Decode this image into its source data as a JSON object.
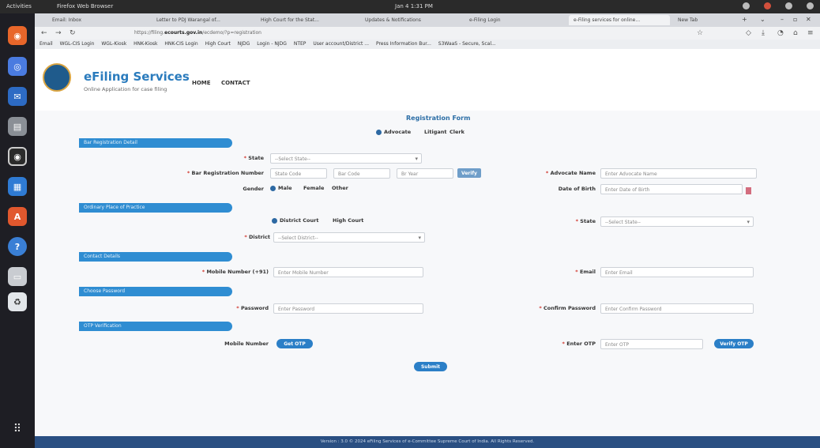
{
  "topbar": {
    "activities": "Activities",
    "app": "Firefox Web Browser",
    "clock": "Jan 4 1:31 PM"
  },
  "dock": {
    "icons": [
      "firefox-icon",
      "chrome-icon",
      "thunderbird-icon",
      "files-icon",
      "rhythmbox-icon",
      "writer-icon",
      "software-icon",
      "help-icon",
      "disk-icon",
      "trash-icon",
      "apps-grid-icon"
    ]
  },
  "browser": {
    "tabs": [
      "Email: Inbox",
      "Letter to PDJ Warangal of...",
      "High Court for the Stat...",
      "Updates & Notifications",
      "e-Filing Login",
      "e-Filing services for online...",
      "New Tab"
    ],
    "url_prefix": "https://filing.",
    "url_domain": "ecourts.gov.in",
    "url_suffix": "/ecdemo/?p=registration",
    "bookmarks": [
      "Email",
      "WGL-CIS Login",
      "WGL-Kiosk",
      "HNK-Kiosk",
      "HNK-CIS Login",
      "High Court",
      "NJDG",
      "Login - NJDG",
      "NTEP",
      "User account/District ...",
      "Press Information Bur...",
      "S3WaaS - Secure, Scal..."
    ]
  },
  "header": {
    "brand": "eFiling Services",
    "tagline": "Online Application for case filing",
    "nav_home": "HOME",
    "nav_contact": "CONTACT"
  },
  "form": {
    "title": "Registration Form",
    "user_types": [
      "Advocate",
      "Litigant",
      "Clerk"
    ],
    "sections": {
      "bar": "Bar Registration Detail",
      "ordinary": "Ordinary Place of Practice",
      "contact": "Contact Details",
      "password": "Choose Password",
      "otp": "OTP Verification"
    },
    "state_label": "State",
    "state_placeholder": "--Select State--",
    "bar_reg_label": "Bar Registration Number",
    "state_code_ph": "State Code",
    "bar_code_ph": "Bar Code",
    "bar_year_ph": "Br Year",
    "verify_label": "Verify",
    "advocate_name_label": "Advocate Name",
    "advocate_name_ph": "Enter Advocate Name",
    "gender_label": "Gender",
    "genders": [
      "Male",
      "Female",
      "Other"
    ],
    "dob_label": "Date of Birth",
    "dob_ph": "Enter Date of Birth",
    "court_types": [
      "District Court",
      "High Court"
    ],
    "state2_label": "State",
    "state2_ph": "--Select State--",
    "district_label": "District",
    "district_ph": "--Select District--",
    "mobile_label": "Mobile Number (+91)",
    "mobile_ph": "Enter Mobile Number",
    "email_label": "Email",
    "email_ph": "Enter Email",
    "password_label": "Password",
    "password_ph": "Enter Password",
    "confirm_label": "Confirm Password",
    "confirm_ph": "Enter Confirm Password",
    "otp_mobile_label": "Mobile Number",
    "get_otp_label": "Get OTP",
    "enter_otp_label": "Enter OTP",
    "enter_otp_ph": "Enter OTP",
    "verify_otp_label": "Verify OTP",
    "submit_label": "Submit"
  },
  "footer": {
    "text": "Version : 3.0 © 2024 eFiling Services of e-Committee Supreme Court of India. All Rights Reserved."
  }
}
